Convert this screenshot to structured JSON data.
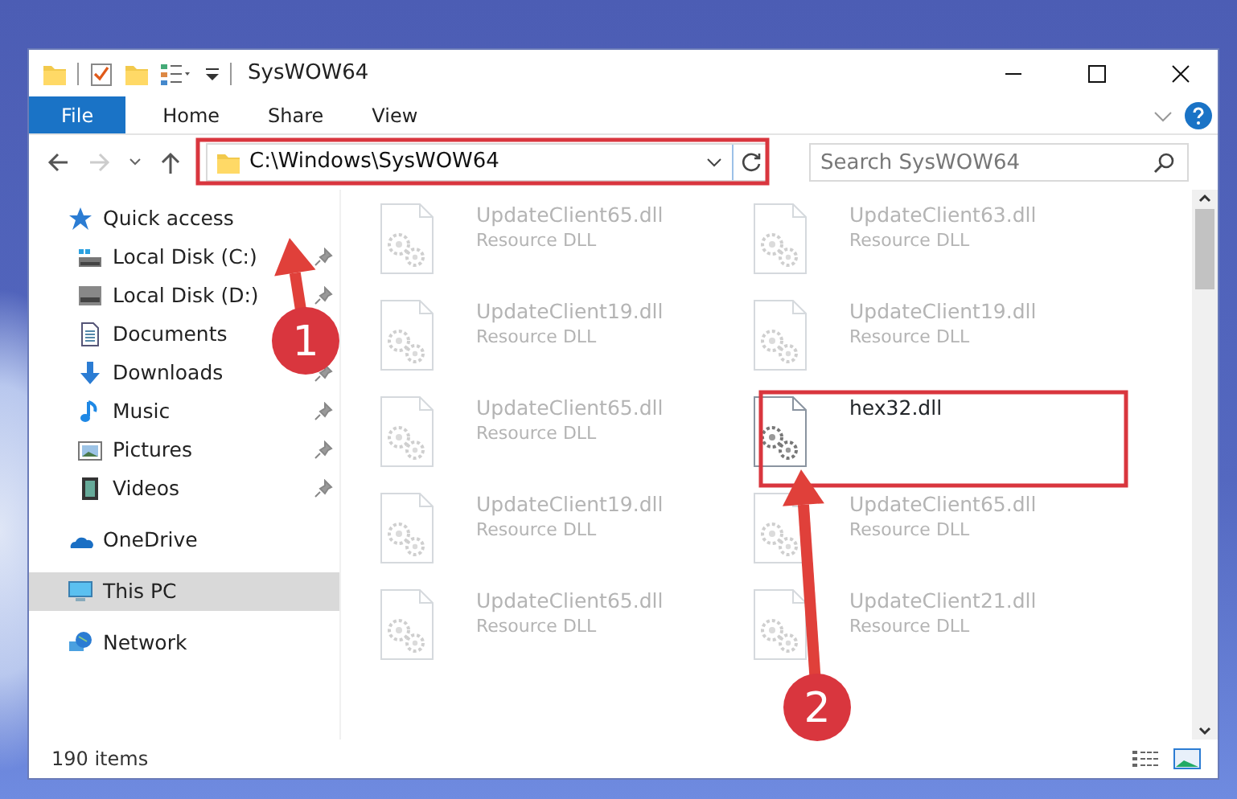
{
  "window": {
    "title": "SysWOW64"
  },
  "ribbon_tabs": [
    {
      "label": "File",
      "selected": true
    },
    {
      "label": "Home",
      "selected": false
    },
    {
      "label": "Share",
      "selected": false
    },
    {
      "label": "View",
      "selected": false
    }
  ],
  "address_bar": {
    "path": "C:\\Windows\\SysWOW64"
  },
  "search": {
    "placeholder": "Search SysWOW64"
  },
  "sidebar": {
    "items": [
      {
        "label": "Quick access",
        "kind": "quick",
        "selected": false
      },
      {
        "label": "Local Disk (C:)",
        "kind": "diskc",
        "pinned": true,
        "selected": false
      },
      {
        "label": "Local Disk (D:)",
        "kind": "disk",
        "pinned": true,
        "selected": false
      },
      {
        "label": "Documents",
        "kind": "docs",
        "pinned": false,
        "selected": false
      },
      {
        "label": "Downloads",
        "kind": "down",
        "pinned": true,
        "selected": false
      },
      {
        "label": "Music",
        "kind": "music",
        "pinned": true,
        "selected": false
      },
      {
        "label": "Pictures",
        "kind": "pics",
        "pinned": true,
        "selected": false
      },
      {
        "label": "Videos",
        "kind": "video",
        "pinned": true,
        "selected": false
      },
      {
        "label": "OneDrive",
        "kind": "cloud",
        "selected": false
      },
      {
        "label": "This PC",
        "kind": "pc",
        "selected": true
      },
      {
        "label": "Network",
        "kind": "net",
        "selected": false
      }
    ]
  },
  "files": [
    {
      "name": "UpdateClient65.dll",
      "type": "Resource DLL",
      "faded": true
    },
    {
      "name": "UpdateClient63.dll",
      "type": "Resource DLL",
      "faded": true
    },
    {
      "name": "UpdateClient19.dll",
      "type": "Resource DLL",
      "faded": true
    },
    {
      "name": "UpdateClient19.dll",
      "type": "Resource DLL",
      "faded": true
    },
    {
      "name": "UpdateClient65.dll",
      "type": "Resource DLL",
      "faded": true
    },
    {
      "name": "hex32.dll",
      "faded": false
    },
    {
      "name": "UpdateClient19.dll",
      "type": "Resource DLL",
      "faded": true
    },
    {
      "name": "UpdateClient65.dll",
      "type": "Resource DLL",
      "faded": true
    },
    {
      "name": "UpdateClient65.dll",
      "type": "Resource DLL",
      "faded": true
    },
    {
      "name": "UpdateClient21.dll",
      "type": "Resource DLL",
      "faded": true
    }
  ],
  "status_bar": {
    "item_count": "190 items"
  },
  "annotations": [
    {
      "label": "1"
    },
    {
      "label": "2"
    }
  ]
}
